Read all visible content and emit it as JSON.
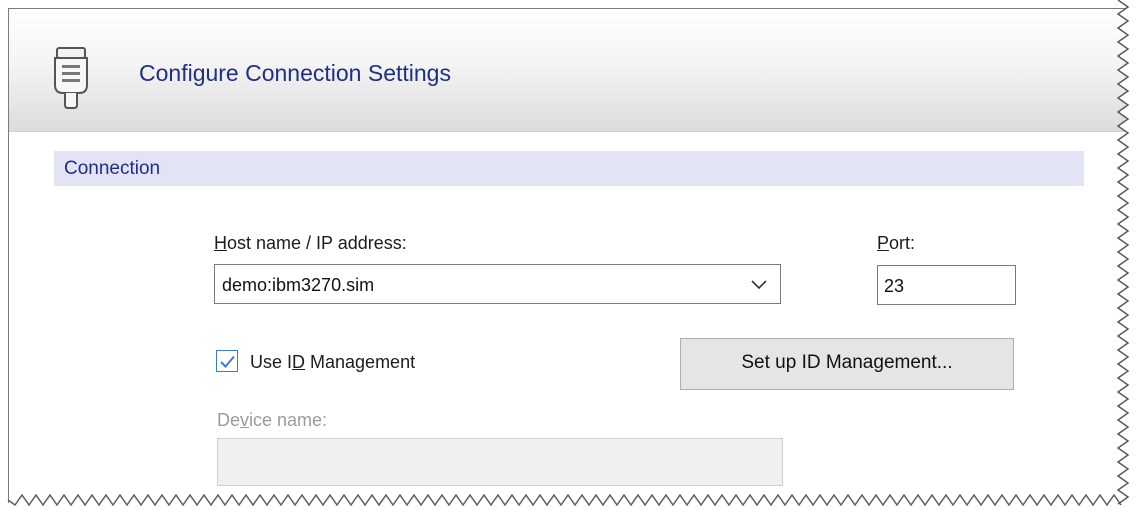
{
  "header": {
    "title": "Configure Connection Settings",
    "icon": "serial-connector-icon"
  },
  "section": {
    "title": "Connection"
  },
  "host": {
    "label_pre": "",
    "label_mnemonic": "H",
    "label_post": "ost name / IP address:",
    "value": "demo:ibm3270.sim"
  },
  "port": {
    "label_pre": "",
    "label_mnemonic": "P",
    "label_post": "ort:",
    "value": "23"
  },
  "id_management": {
    "checked": true,
    "label_pre": "Use I",
    "label_mnemonic": "D",
    "label_post": " Management"
  },
  "setup_button": {
    "label_pre": "Set up ID Mana",
    "label_mnemonic": "g",
    "label_post": "ement..."
  },
  "device": {
    "label_pre": "De",
    "label_mnemonic": "v",
    "label_post": "ice name:",
    "value": "",
    "enabled": false
  },
  "colors": {
    "title_blue": "#1f2f86",
    "section_bg": "#e3e3f6",
    "check_blue": "#3a7bd5",
    "disabled_text": "#9b9b9b"
  }
}
